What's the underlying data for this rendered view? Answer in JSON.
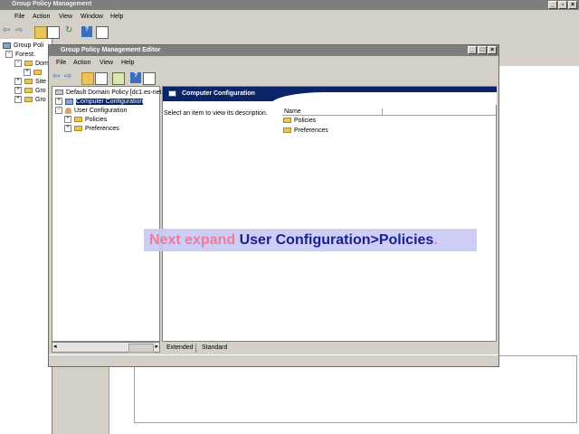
{
  "outer": {
    "title": "Group Policy Management",
    "menu": [
      "File",
      "Action",
      "View",
      "Window",
      "Help"
    ],
    "tree": [
      "Group Poli",
      "Forest:",
      "Dom",
      "",
      "Site",
      "Gro",
      "Gro"
    ]
  },
  "editor": {
    "title": "Group Policy Management Editor",
    "menu": [
      "File",
      "Action",
      "View",
      "Help"
    ],
    "tree": {
      "root": "Default Domain Policy [dc1.es-net.",
      "computer": "Computer Configuration",
      "user": "User Configuration",
      "policies": "Policies",
      "preferences": "Preferences"
    },
    "header_title": "Computer Configuration",
    "description": "Select an item to view its description.",
    "list_header": "Name",
    "list_items": [
      "Policies",
      "Preferences"
    ],
    "tabs": [
      "Extended",
      "Standard"
    ]
  },
  "caption": {
    "part1": "Next expand ",
    "part2": "User Configuration>Policies",
    "part3": "."
  },
  "colors": {
    "title_bar": "#7e7e7e",
    "header_bar": "#0a246a",
    "caption_pink": "#f07a9a",
    "caption_blue": "#1a2090"
  }
}
